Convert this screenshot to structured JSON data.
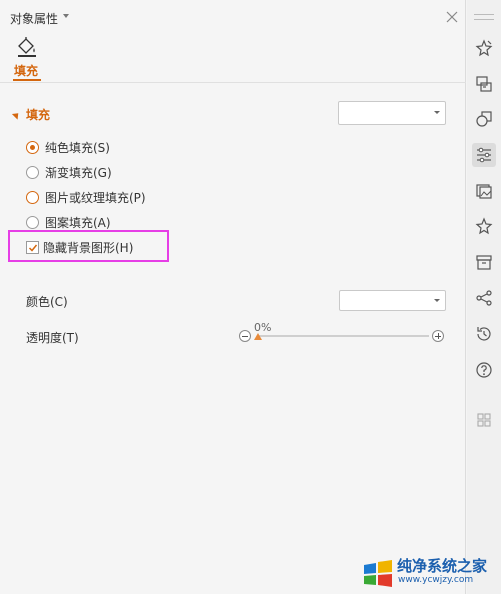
{
  "header": {
    "title": "对象属性"
  },
  "tabs": {
    "fill_label": "填充"
  },
  "section": {
    "title": "填充"
  },
  "fill_options": [
    {
      "label": "纯色填充(S)",
      "checked": true
    },
    {
      "label": "渐变填充(G)",
      "checked": false
    },
    {
      "label": "图片或纹理填充(P)",
      "checked": false
    },
    {
      "label": "图案填充(A)",
      "checked": false
    }
  ],
  "hide_background": {
    "label": "隐藏背景图形(H)",
    "checked": true
  },
  "color": {
    "label": "颜色(C)"
  },
  "transparency": {
    "label": "透明度(T)",
    "value": "0%"
  },
  "sidebar": {
    "icons": [
      "magic-star-icon",
      "shape-swap-icon",
      "shapes-icon",
      "property-settings-icon",
      "image-gallery-icon",
      "favorites-star-icon",
      "archive-icon",
      "share-icon",
      "history-icon",
      "help-icon",
      "app-grid-icon"
    ]
  },
  "watermark": {
    "line1": "纯净系统之家",
    "line2": "www.ycwjzy.com"
  },
  "colors": {
    "accent": "#d4670f",
    "highlight": "#e63ee6"
  }
}
